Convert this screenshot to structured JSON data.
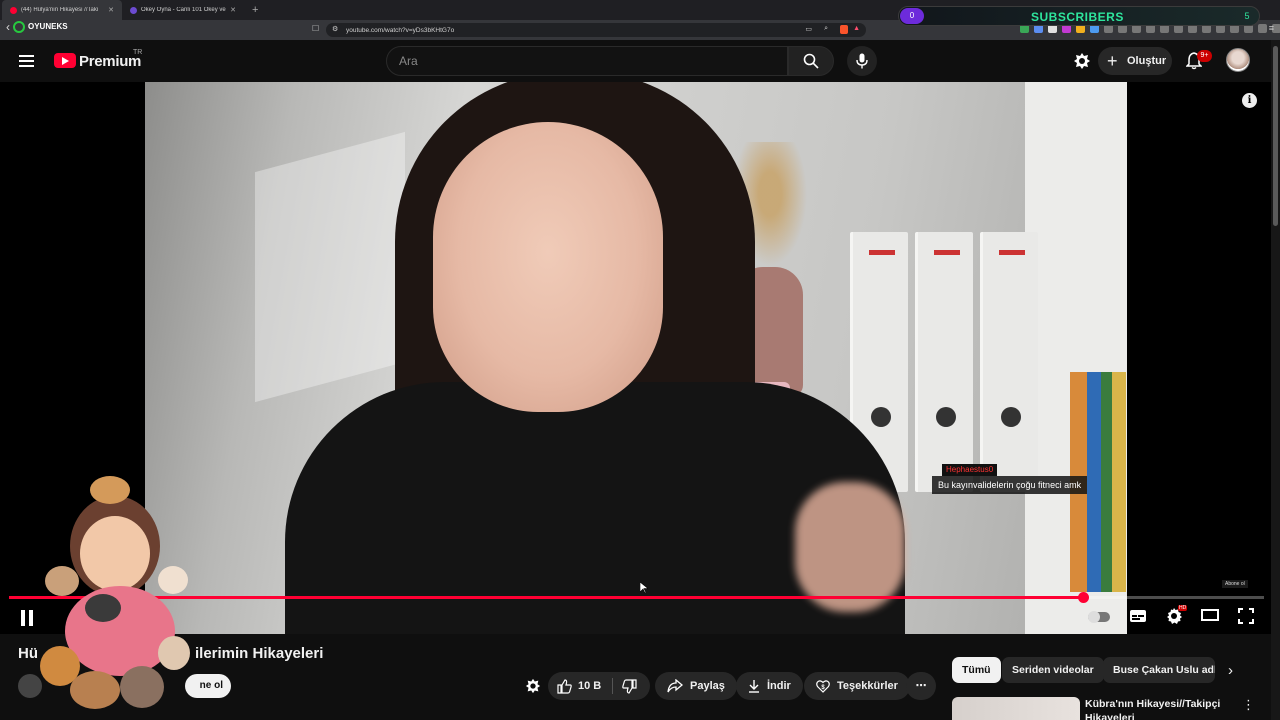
{
  "browser": {
    "tabs": [
      {
        "label": "(44) Hülya'nın Hikayesi //Taki"
      },
      {
        "label": "Okey Oyna - Canlı 101 Okey ve Düz"
      }
    ],
    "new_tab_label": "+",
    "url": "youtube.com/watch?v=yDs3bKHtG7o",
    "brand": "OYUNEKS"
  },
  "overlay": {
    "subscribers_label": "SUBSCRIBERS",
    "left_value": "0",
    "right_value": "5"
  },
  "header": {
    "logo_text": "Premium",
    "region": "TR",
    "search_placeholder": "Ara",
    "create_label": "Oluştur",
    "notification_badge": "9+"
  },
  "player": {
    "progress_fraction": 0.856,
    "chat_username": "Hephaestus0",
    "chat_message": "Bu kayınvalidelerin çoğu fitneci amk",
    "mini_subscribe": "Abone ol",
    "hd_badge": "HD"
  },
  "video": {
    "title_start": "Hü",
    "title_end": "ilerimin Hikayeleri",
    "subscribe_label": "ne ol",
    "like_count": "10 B",
    "share_label": "Paylaş",
    "download_label": "İndir",
    "thanks_label": "Teşekkürler",
    "more_label": "⋯"
  },
  "recommendations": {
    "chips": [
      "Tümü",
      "Seriden videolar",
      "Buse Çakan Uslu adlı"
    ],
    "first_title": "Kübra'nın Hikayesi//Takipçi Hikayeleri"
  },
  "colors": {
    "accent": "#ff0033",
    "subscriber_green": "#2ee59d",
    "background": "#0f0f0f"
  }
}
